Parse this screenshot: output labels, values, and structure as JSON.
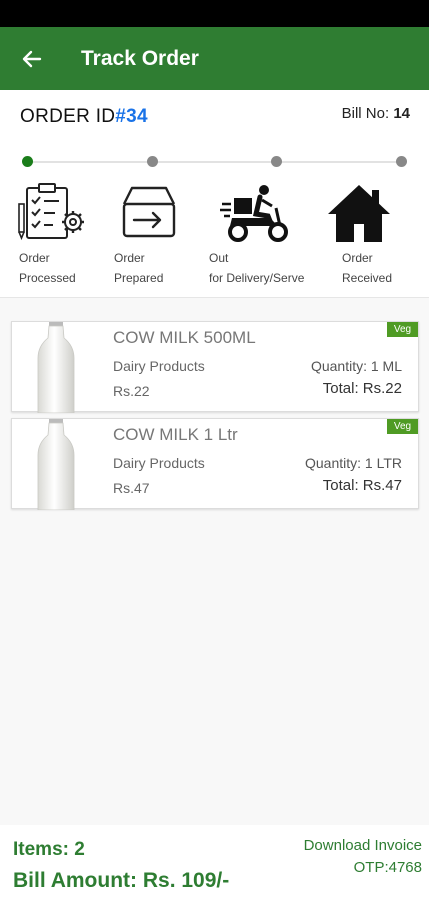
{
  "header": {
    "title": "Track Order"
  },
  "order": {
    "id_label": "ORDER ID",
    "id_number": "#34",
    "bill_label": "Bill No:",
    "bill_number": "14"
  },
  "steps": [
    {
      "line1": "Order",
      "line2": "Processed",
      "icon": "checklist-gear-icon",
      "active": true
    },
    {
      "line1": "Order",
      "line2": "Prepared",
      "icon": "box-arrow-icon",
      "active": false
    },
    {
      "line1": "Out",
      "line2": "for Delivery/Serve",
      "icon": "delivery-scooter-icon",
      "active": false
    },
    {
      "line1": "Order",
      "line2": "Received",
      "icon": "house-icon",
      "active": false
    }
  ],
  "items": [
    {
      "name": "COW MILK 500ML",
      "category": "Dairy Products",
      "price": "Rs.22",
      "quantity": "Quantity: 1 ML",
      "total": "Total: Rs.22",
      "badge": "Veg"
    },
    {
      "name": "COW MILK 1 Ltr",
      "category": "Dairy Products",
      "price": "Rs.47",
      "quantity": "Quantity: 1 LTR",
      "total": "Total: Rs.47",
      "badge": "Veg"
    }
  ],
  "footer": {
    "items_label": "Items:  2",
    "bill_amount": "Bill Amount:  Rs. 109/-",
    "download": "Download Invoice",
    "otp": "OTP:4768"
  },
  "colors": {
    "primary": "#2f7d32",
    "accent_blue": "#1a73e8",
    "veg_badge": "#4f9b24"
  }
}
